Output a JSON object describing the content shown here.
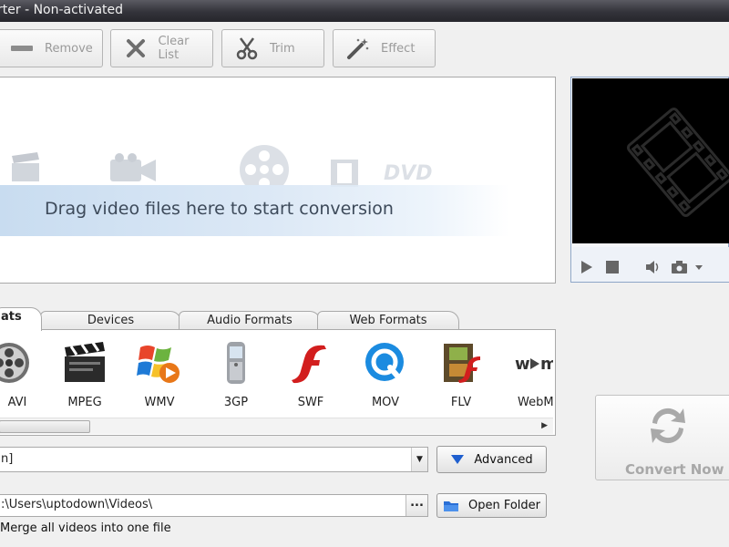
{
  "window": {
    "title": "rter - Non-activated"
  },
  "toolbar": {
    "remove": "Remove",
    "clear_list": "Clear List",
    "trim": "Trim",
    "effect": "Effect"
  },
  "droparea": {
    "hint": "Drag video files here to start conversion"
  },
  "tabs": [
    {
      "label": "ats",
      "active": true
    },
    {
      "label": "Devices",
      "active": false
    },
    {
      "label": "Audio Formats",
      "active": false
    },
    {
      "label": "Web Formats",
      "active": false
    }
  ],
  "formats": [
    {
      "label": "AVI",
      "icon": "film-reel-icon"
    },
    {
      "label": "MPEG",
      "icon": "clapperboard-icon"
    },
    {
      "label": "WMV",
      "icon": "windows-logo-icon"
    },
    {
      "label": "3GP",
      "icon": "mobile-phone-icon"
    },
    {
      "label": "SWF",
      "icon": "flash-icon"
    },
    {
      "label": "MOV",
      "icon": "quicktime-icon"
    },
    {
      "label": "FLV",
      "icon": "flash-video-icon"
    },
    {
      "label": "WebM",
      "icon": "webm-icon"
    }
  ],
  "profile": {
    "value": "n]",
    "advanced_label": "Advanced"
  },
  "output": {
    "path": ":\\Users\\uptodown\\Videos\\",
    "browse_label": "...",
    "open_folder_label": "Open Folder"
  },
  "merge": {
    "label": "Merge all videos into one file"
  },
  "convert": {
    "label": "Convert Now"
  },
  "colors": {
    "titlebar": "#33333a",
    "accent_blue": "#1f5fcf",
    "banner": "#c8dcf0"
  }
}
